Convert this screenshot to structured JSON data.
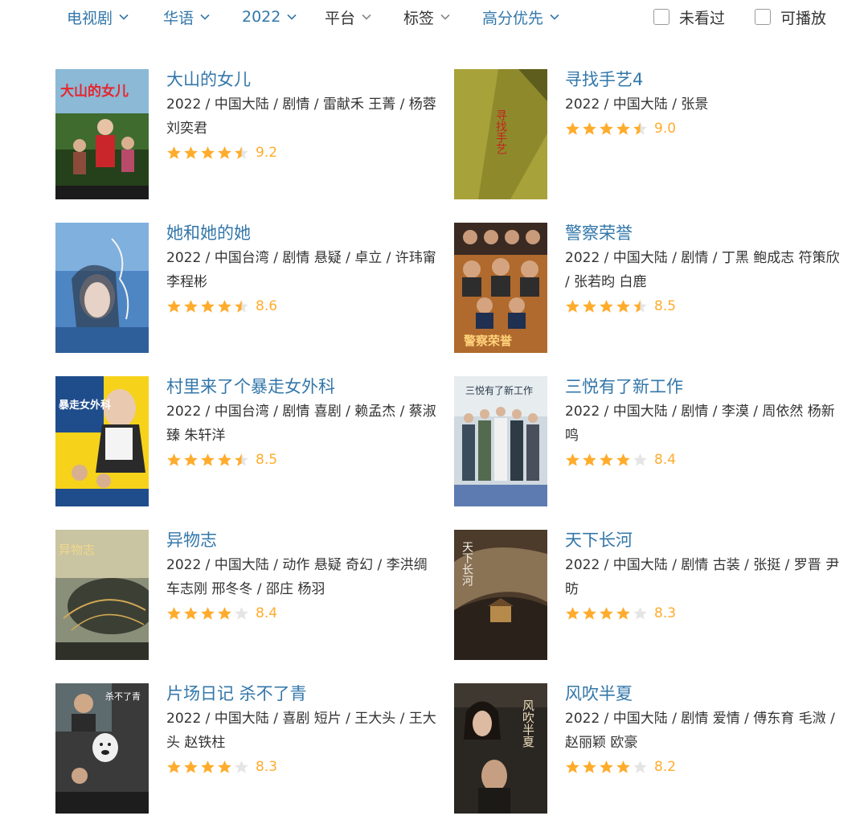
{
  "filters": [
    {
      "label": "电视剧",
      "active": true
    },
    {
      "label": "华语",
      "active": true
    },
    {
      "label": "2022",
      "active": true
    },
    {
      "label": "平台",
      "active": false
    },
    {
      "label": "标签",
      "active": false
    },
    {
      "label": "高分优先",
      "active": true
    }
  ],
  "checkboxes": [
    {
      "label": "未看过",
      "checked": false
    },
    {
      "label": "可播放",
      "checked": false
    }
  ],
  "colors": {
    "link": "#3377aa",
    "text": "#333333",
    "star": "#ffac2d",
    "star_empty": "#e5e5e5"
  },
  "items": [
    {
      "title": "大山的女儿",
      "meta": "2022 / 中国大陆 / 剧情 / 雷献禾 王菁 / 杨蓉 刘奕君",
      "stars": 4.5,
      "score": "9.2",
      "poster_text": "大山的女儿"
    },
    {
      "title": "寻找手艺4",
      "meta": "2022 / 中国大陆 / 张景",
      "stars": 4.5,
      "score": "9.0",
      "poster_text": "寻找手艺"
    },
    {
      "title": "她和她的她",
      "meta": "2022 / 中国台湾 / 剧情 悬疑 / 卓立 / 许玮甯 李程彬",
      "stars": 4.5,
      "score": "8.6",
      "poster_text": ""
    },
    {
      "title": "警察荣誉",
      "meta": "2022 / 中国大陆 / 剧情 / 丁黑 鲍成志 符策欣 / 张若昀 白鹿",
      "stars": 4.5,
      "score": "8.5",
      "poster_text": "警察荣誉"
    },
    {
      "title": "村里来了个暴走女外科",
      "meta": "2022 / 中国台湾 / 剧情 喜剧 / 赖孟杰 / 蔡淑臻 朱轩洋",
      "stars": 4.5,
      "score": "8.5",
      "poster_text": "暴走女外科"
    },
    {
      "title": "三悦有了新工作",
      "meta": "2022 / 中国大陆 / 剧情 / 李漠 / 周依然 杨新鸣",
      "stars": 4,
      "score": "8.4",
      "poster_text": "三悦有了新工作"
    },
    {
      "title": "异物志",
      "meta": "2022 / 中国大陆 / 动作 悬疑 奇幻 / 李洪绸 车志刚 邢冬冬 / 邵庄 杨羽",
      "stars": 4,
      "score": "8.4",
      "poster_text": "异物志"
    },
    {
      "title": "天下长河",
      "meta": "2022 / 中国大陆 / 剧情 古装 / 张挺 / 罗晋 尹昉",
      "stars": 4,
      "score": "8.3",
      "poster_text": "天下长河"
    },
    {
      "title": "片场日记 杀不了青",
      "meta": "2022 / 中国大陆 / 喜剧 短片 / 王大头 / 王大头 赵铁柱",
      "stars": 4,
      "score": "8.3",
      "poster_text": "杀不了青"
    },
    {
      "title": "风吹半夏",
      "meta": "2022 / 中国大陆 / 剧情 爱情 / 傅东育 毛溦 / 赵丽颖 欧豪",
      "stars": 4,
      "score": "8.2",
      "poster_text": "风吹半夏"
    }
  ]
}
